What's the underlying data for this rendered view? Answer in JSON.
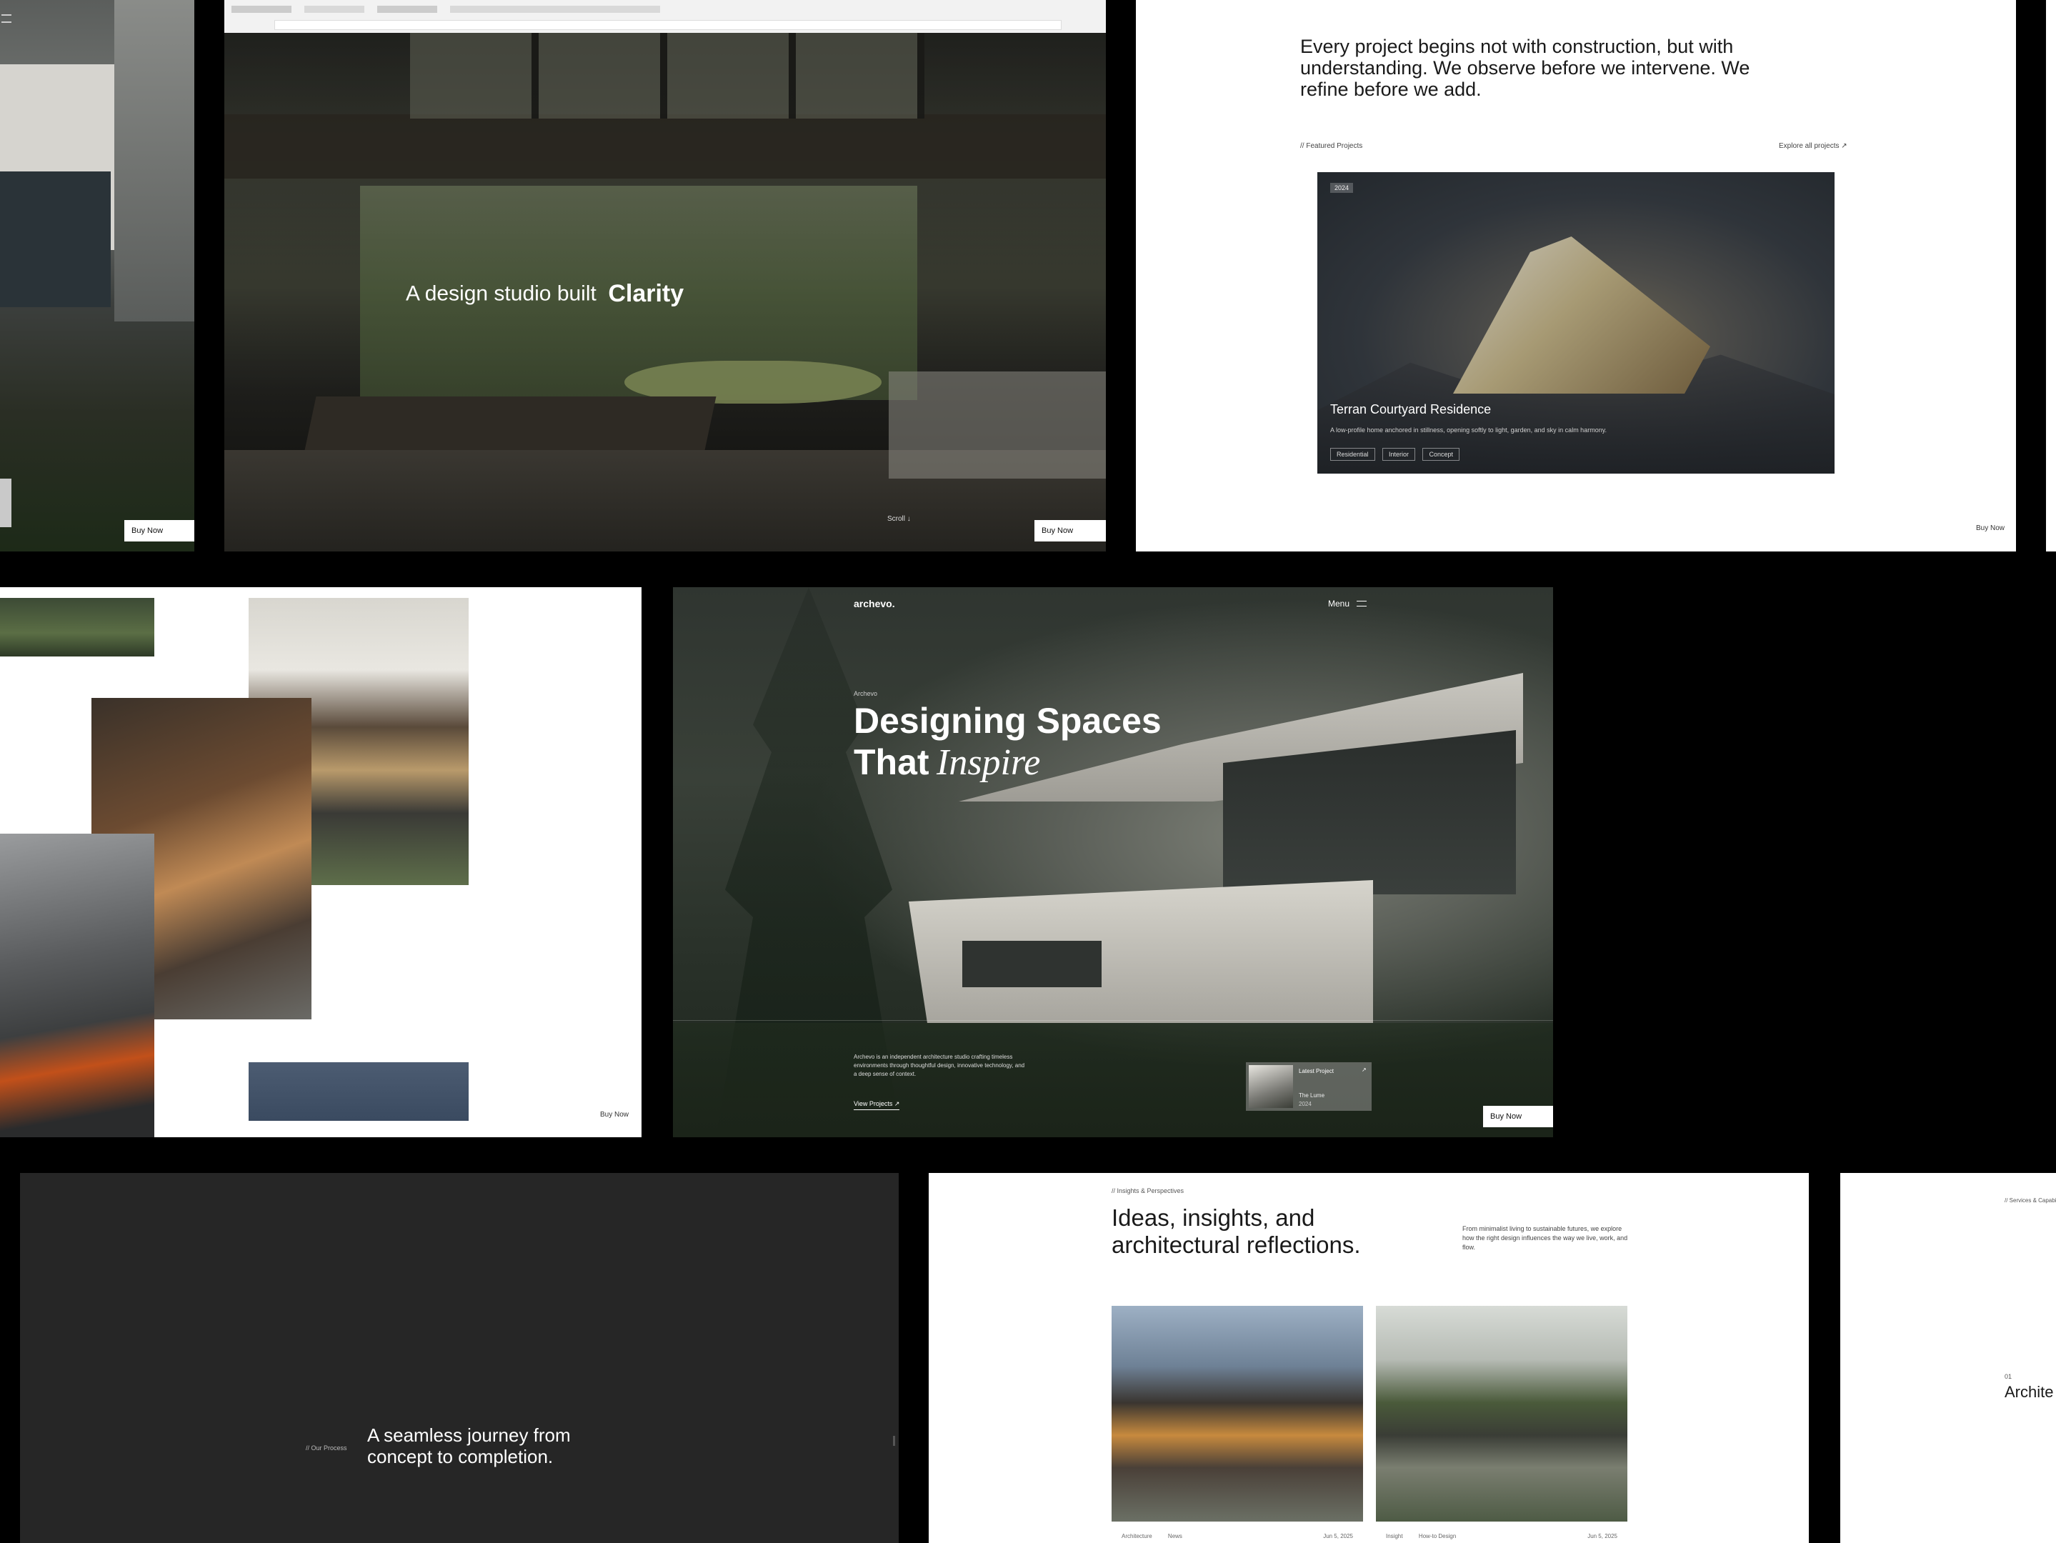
{
  "colors": {
    "background": "#000000",
    "panel_light": "#ffffff",
    "panel_dark": "#262626",
    "text_dark": "#1a1a1a",
    "text_light": "#ffffff"
  },
  "panel_left_house": {
    "buy_button": "Buy Now"
  },
  "panel_hero_interior": {
    "headline_prefix": "A design studio built",
    "headline_emphasis": "Clarity",
    "scroll_label": "Scroll ↓",
    "buy_button": "Buy Now"
  },
  "panel_featured": {
    "intro": "Every project begins not with construction, but with understanding. We observe before we intervene. We refine before we add.",
    "section_label": "// Featured Projects",
    "explore_link": "Explore all projects ↗",
    "card": {
      "badge": "2024",
      "title": "Terran Courtyard Residence",
      "description": "A low-profile home anchored in stillness, opening softly to light, garden, and sky in calm harmony.",
      "tags": [
        "Residential",
        "Interior",
        "Concept"
      ]
    },
    "buy_button": "Buy Now"
  },
  "panel_gallery": {
    "buy_button": "Buy Now"
  },
  "panel_main_hero": {
    "logo": "archevo.",
    "menu_label": "Menu",
    "eyebrow": "Archevo",
    "headline_line1": "Designing Spaces",
    "headline_line2_prefix": "That",
    "headline_line2_emphasis": "Inspire",
    "description": "Archevo is an independent architecture studio crafting timeless environments through thoughtful design, innovative technology, and a deep sense of context.",
    "view_projects": "View Projects ↗",
    "latest_card": {
      "title": "Latest Project",
      "line1": "The Lume",
      "line2": "2024"
    },
    "buy_button": "Buy Now"
  },
  "panel_process": {
    "label": "// Our Process",
    "headline": "A seamless journey from concept to completion."
  },
  "panel_insights": {
    "eyebrow": "// Insights & Perspectives",
    "headline": "Ideas, insights, and architectural reflections.",
    "description": "From minimalist living to sustainable futures, we explore how the right design influences the way we live, work, and flow.",
    "posts": [
      {
        "category": "Architecture",
        "type": "News",
        "date": "Jun 5, 2025"
      },
      {
        "category": "Insight",
        "type": "How-to Design",
        "date": "Jun 5, 2025"
      }
    ]
  },
  "panel_right_edge": {
    "label": "// Services & Capabilities",
    "number": "01",
    "title": "Archite"
  }
}
